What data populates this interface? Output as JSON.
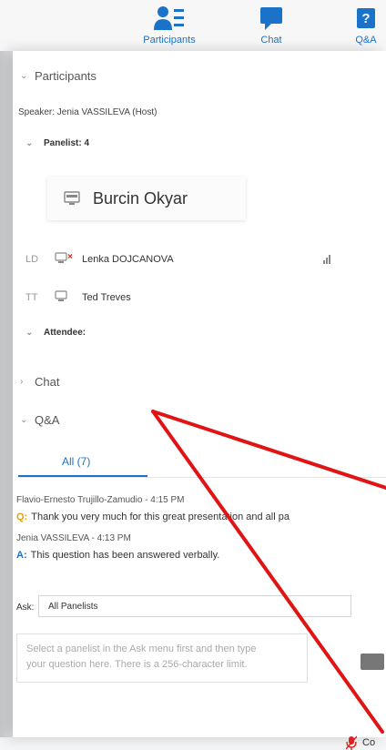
{
  "toolbar": {
    "participants_label": "Participants",
    "chat_label": "Chat",
    "qa_label": "Q&A"
  },
  "participants_section": {
    "title": "Participants",
    "speaker": "Speaker: Jenia VASSILEVA (Host)",
    "panelist_header": "Panelist: 4",
    "hover_card_name": "Burcin Okyar",
    "rows": [
      {
        "initials": "LD",
        "name": "Lenka DOJCANOVA"
      },
      {
        "initials": "TT",
        "name": "Ted Treves"
      }
    ],
    "attendee_header": "Attendee:"
  },
  "chat_section": {
    "title": "Chat"
  },
  "qa_section": {
    "title": "Q&A",
    "tab_all": "All (7)",
    "entries": [
      {
        "meta": "Flavio-Ernesto Trujillo-Zamudio - 4:15 PM",
        "prefix": "Q:",
        "text": "Thank you very much for this great presentation and all pa"
      },
      {
        "meta": "Jenia VASSILEVA - 4:13 PM",
        "prefix": "A:",
        "text": "This question has been answered verbally."
      }
    ],
    "ask_label": "Ask:",
    "ask_selected": "All Panelists",
    "question_placeholder_line1": "Select a panelist in the Ask menu first and then type",
    "question_placeholder_line2": "your question here. There is a 256-character limit."
  },
  "bottom": {
    "mic_text": "Co"
  },
  "colors": {
    "accent": "#1a73c8",
    "question_prefix": "#e0a31c",
    "annotation_red": "#e01414"
  },
  "icons": {
    "participants": "participants-list-icon",
    "chat": "chat-bubble-icon",
    "qa": "question-mark-icon",
    "pc": "computer-icon",
    "signal": "signal-bars-icon",
    "mic": "muted-mic-icon"
  }
}
